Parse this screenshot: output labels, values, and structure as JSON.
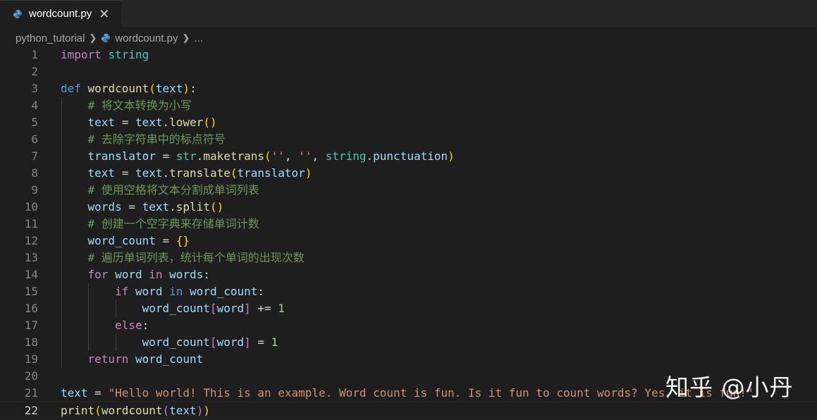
{
  "tab": {
    "filename": "wordcount.py",
    "close": "✕",
    "icon": "python-file-icon"
  },
  "breadcrumb": {
    "folder": "python_tutorial",
    "file": "wordcount.py",
    "more": "..."
  },
  "watermark": "知乎 @小丹",
  "editor": {
    "active_line": 22,
    "lines": [
      {
        "n": "1",
        "t": [
          [
            "kw-import",
            "import"
          ],
          [
            "op",
            " "
          ],
          [
            "mod",
            "string"
          ]
        ]
      },
      {
        "n": "2",
        "t": []
      },
      {
        "n": "3",
        "t": [
          [
            "kw-def",
            "def"
          ],
          [
            "op",
            " "
          ],
          [
            "fn",
            "wordcount"
          ],
          [
            "p1",
            "("
          ],
          [
            "var",
            "text"
          ],
          [
            "p1",
            ")"
          ],
          [
            "op",
            ":"
          ]
        ]
      },
      {
        "n": "4",
        "t": [
          [
            "op",
            "    "
          ],
          [
            "cm",
            "# 将文本转换为小写"
          ]
        ]
      },
      {
        "n": "5",
        "t": [
          [
            "op",
            "    "
          ],
          [
            "var",
            "text"
          ],
          [
            "op",
            " = "
          ],
          [
            "var",
            "text"
          ],
          [
            "op",
            "."
          ],
          [
            "fn",
            "lower"
          ],
          [
            "p1",
            "()"
          ]
        ]
      },
      {
        "n": "6",
        "t": [
          [
            "op",
            "    "
          ],
          [
            "cm",
            "# 去除字符串中的标点符号"
          ]
        ]
      },
      {
        "n": "7",
        "t": [
          [
            "op",
            "    "
          ],
          [
            "var",
            "translator"
          ],
          [
            "op",
            " = "
          ],
          [
            "mod",
            "str"
          ],
          [
            "op",
            "."
          ],
          [
            "fn",
            "maketrans"
          ],
          [
            "p1",
            "("
          ],
          [
            "str",
            "''"
          ],
          [
            "op",
            ", "
          ],
          [
            "str",
            "''"
          ],
          [
            "op",
            ", "
          ],
          [
            "mod",
            "string"
          ],
          [
            "op",
            "."
          ],
          [
            "var",
            "punctuation"
          ],
          [
            "p1",
            ")"
          ]
        ]
      },
      {
        "n": "8",
        "t": [
          [
            "op",
            "    "
          ],
          [
            "var",
            "text"
          ],
          [
            "op",
            " = "
          ],
          [
            "var",
            "text"
          ],
          [
            "op",
            "."
          ],
          [
            "fn",
            "translate"
          ],
          [
            "p1",
            "("
          ],
          [
            "var",
            "translator"
          ],
          [
            "p1",
            ")"
          ]
        ]
      },
      {
        "n": "9",
        "t": [
          [
            "op",
            "    "
          ],
          [
            "cm",
            "# 使用空格将文本分割成单词列表"
          ]
        ]
      },
      {
        "n": "10",
        "t": [
          [
            "op",
            "    "
          ],
          [
            "var",
            "words"
          ],
          [
            "op",
            " = "
          ],
          [
            "var",
            "text"
          ],
          [
            "op",
            "."
          ],
          [
            "fn",
            "split"
          ],
          [
            "p1",
            "()"
          ]
        ]
      },
      {
        "n": "11",
        "t": [
          [
            "op",
            "    "
          ],
          [
            "cm",
            "# 创建一个空字典来存储单词计数"
          ]
        ]
      },
      {
        "n": "12",
        "t": [
          [
            "op",
            "    "
          ],
          [
            "var",
            "word_count"
          ],
          [
            "op",
            " = "
          ],
          [
            "p1",
            "{}"
          ]
        ]
      },
      {
        "n": "13",
        "t": [
          [
            "op",
            "    "
          ],
          [
            "cm",
            "# 遍历单词列表，统计每个单词的出现次数"
          ]
        ]
      },
      {
        "n": "14",
        "t": [
          [
            "op",
            "    "
          ],
          [
            "kw-import",
            "for"
          ],
          [
            "op",
            " "
          ],
          [
            "var",
            "word"
          ],
          [
            "op",
            " "
          ],
          [
            "kw-import",
            "in"
          ],
          [
            "op",
            " "
          ],
          [
            "var",
            "words"
          ],
          [
            "op",
            ":"
          ]
        ]
      },
      {
        "n": "15",
        "t": [
          [
            "op",
            "        "
          ],
          [
            "kw-import",
            "if"
          ],
          [
            "op",
            " "
          ],
          [
            "var",
            "word"
          ],
          [
            "op",
            " "
          ],
          [
            "kw-def",
            "in"
          ],
          [
            "op",
            " "
          ],
          [
            "var",
            "word_count"
          ],
          [
            "op",
            ":"
          ]
        ]
      },
      {
        "n": "16",
        "t": [
          [
            "op",
            "            "
          ],
          [
            "var",
            "word_count"
          ],
          [
            "p2",
            "["
          ],
          [
            "var",
            "word"
          ],
          [
            "p2",
            "]"
          ],
          [
            "op",
            " += "
          ],
          [
            "num",
            "1"
          ]
        ]
      },
      {
        "n": "17",
        "t": [
          [
            "op",
            "        "
          ],
          [
            "kw-import",
            "else"
          ],
          [
            "op",
            ":"
          ]
        ]
      },
      {
        "n": "18",
        "t": [
          [
            "op",
            "            "
          ],
          [
            "var",
            "word_count"
          ],
          [
            "p2",
            "["
          ],
          [
            "var",
            "word"
          ],
          [
            "p2",
            "]"
          ],
          [
            "op",
            " = "
          ],
          [
            "num",
            "1"
          ]
        ]
      },
      {
        "n": "19",
        "t": [
          [
            "op",
            "    "
          ],
          [
            "kw-import",
            "return"
          ],
          [
            "op",
            " "
          ],
          [
            "var",
            "word_count"
          ]
        ]
      },
      {
        "n": "20",
        "t": []
      },
      {
        "n": "21",
        "t": [
          [
            "var",
            "text"
          ],
          [
            "op",
            " = "
          ],
          [
            "str",
            "\"Hello world! This is an example. Word count is fun. Is it fun to count words? Yes, it is fun!\""
          ]
        ]
      },
      {
        "n": "22",
        "t": [
          [
            "fn",
            "print"
          ],
          [
            "p1",
            "("
          ],
          [
            "fn",
            "wordcount"
          ],
          [
            "p2",
            "("
          ],
          [
            "var",
            "text"
          ],
          [
            "p2",
            ")"
          ],
          [
            "p1",
            ")"
          ]
        ]
      }
    ]
  }
}
